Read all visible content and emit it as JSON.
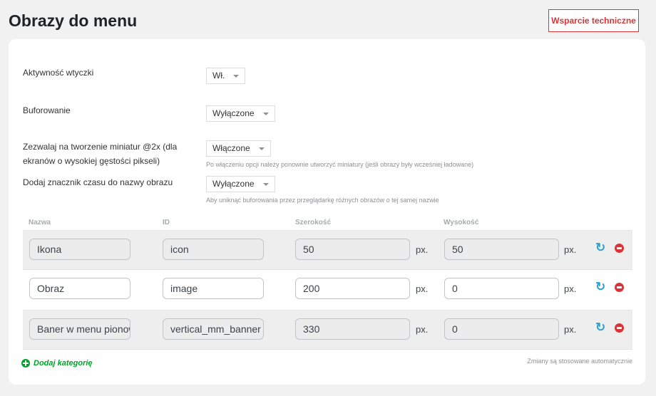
{
  "page": {
    "title": "Obrazy do menu",
    "support_label": "Wsparcie techniczne"
  },
  "settings": [
    {
      "label": "Aktywność wtyczki",
      "value": "Wł.",
      "hint": ""
    },
    {
      "label": "Buforowanie",
      "value": "Wyłączone",
      "hint": ""
    },
    {
      "label": "Zezwalaj na tworzenie miniatur @2x (dla ekranów o wysokiej gęstości pikseli)",
      "value": "Włączone",
      "hint": "Po włączeniu opcji należy ponownie utworzyć miniatury (jeśli obrazy były wcześniej ładowane)"
    },
    {
      "label": "Dodaj znacznik czasu do nazwy obrazu",
      "value": "Wyłączone",
      "hint": "Aby uniknąć buforowania przez przeglądarkę różnych obrazów o tej samej nazwie"
    }
  ],
  "table": {
    "headers": {
      "name": "Nazwa",
      "id": "ID",
      "width": "Szerokość",
      "height": "Wysokość"
    },
    "unit": "px.",
    "rows": [
      {
        "name": "Ikona",
        "id": "icon",
        "width": "50",
        "height": "50"
      },
      {
        "name": "Obraz",
        "id": "image",
        "width": "200",
        "height": "0"
      },
      {
        "name": "Baner w menu pionowym",
        "id": "vertical_mm_banner",
        "width": "330",
        "height": "0"
      }
    ]
  },
  "footer": {
    "add_category": "Dodaj kategorię",
    "autosave_note": "Zmiany są stosowane automatycznie"
  },
  "icons": {
    "refresh": "refresh-icon",
    "remove": "remove-icon",
    "add": "plus-circle-icon",
    "dropdown": "caret-down-icon"
  },
  "colors": {
    "accent_red": "#d63638",
    "accent_blue": "#2ea2cc",
    "accent_green": "#00a32a"
  }
}
